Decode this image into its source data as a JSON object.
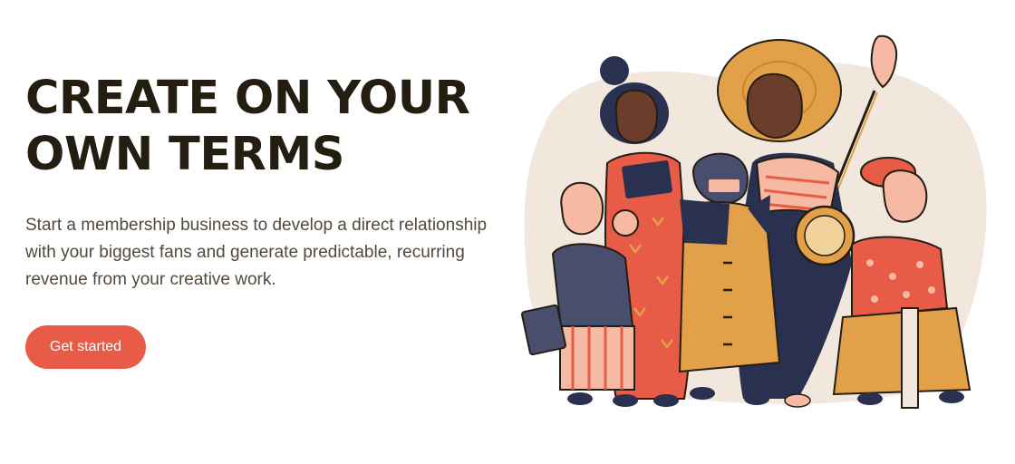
{
  "hero": {
    "headline_line1": "CREATE ON YOUR",
    "headline_line2": "OWN TERMS",
    "description": "Start a membership business to develop a direct relationship with your biggest fans and generate predictable, recurring revenue from your creative work.",
    "cta_label": "Get started"
  },
  "illustration": {
    "subject": "group-of-creators-illustration",
    "colors": {
      "backdrop": "#f1e7dd",
      "navy": "#2a3150",
      "coral": "#e85b46",
      "mustard": "#e2a049",
      "peach": "#f6b9a3",
      "skin_dark": "#6a3e2a"
    }
  }
}
